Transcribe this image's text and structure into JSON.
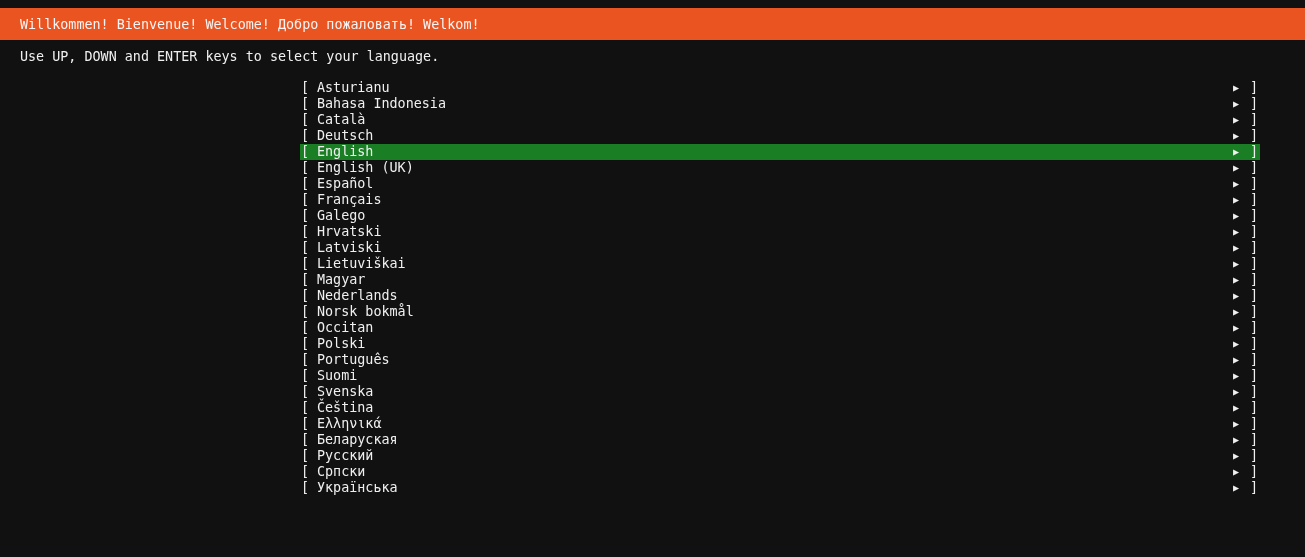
{
  "header": {
    "title": "Willkommen! Bienvenue! Welcome! Добро пожаловать! Welkom!"
  },
  "instruction": "Use UP, DOWN and ENTER keys to select your language.",
  "languages": [
    {
      "open": "[",
      "label": "Asturianu",
      "arrow": "▶",
      "close": "]",
      "selected": false
    },
    {
      "open": "[",
      "label": "Bahasa Indonesia",
      "arrow": "▶",
      "close": "]",
      "selected": false
    },
    {
      "open": "[",
      "label": "Català",
      "arrow": "▶",
      "close": "]",
      "selected": false
    },
    {
      "open": "[",
      "label": "Deutsch",
      "arrow": "▶",
      "close": "]",
      "selected": false
    },
    {
      "open": "[",
      "label": "English",
      "arrow": "▶",
      "close": "]",
      "selected": true
    },
    {
      "open": "[",
      "label": "English (UK)",
      "arrow": "▶",
      "close": "]",
      "selected": false
    },
    {
      "open": "[",
      "label": "Español",
      "arrow": "▶",
      "close": "]",
      "selected": false
    },
    {
      "open": "[",
      "label": "Français",
      "arrow": "▶",
      "close": "]",
      "selected": false
    },
    {
      "open": "[",
      "label": "Galego",
      "arrow": "▶",
      "close": "]",
      "selected": false
    },
    {
      "open": "[",
      "label": "Hrvatski",
      "arrow": "▶",
      "close": "]",
      "selected": false
    },
    {
      "open": "[",
      "label": "Latviski",
      "arrow": "▶",
      "close": "]",
      "selected": false
    },
    {
      "open": "[",
      "label": "Lietuviškai",
      "arrow": "▶",
      "close": "]",
      "selected": false
    },
    {
      "open": "[",
      "label": "Magyar",
      "arrow": "▶",
      "close": "]",
      "selected": false
    },
    {
      "open": "[",
      "label": "Nederlands",
      "arrow": "▶",
      "close": "]",
      "selected": false
    },
    {
      "open": "[",
      "label": "Norsk bokmål",
      "arrow": "▶",
      "close": "]",
      "selected": false
    },
    {
      "open": "[",
      "label": "Occitan",
      "arrow": "▶",
      "close": "]",
      "selected": false
    },
    {
      "open": "[",
      "label": "Polski",
      "arrow": "▶",
      "close": "]",
      "selected": false
    },
    {
      "open": "[",
      "label": "Português",
      "arrow": "▶",
      "close": "]",
      "selected": false
    },
    {
      "open": "[",
      "label": "Suomi",
      "arrow": "▶",
      "close": "]",
      "selected": false
    },
    {
      "open": "[",
      "label": "Svenska",
      "arrow": "▶",
      "close": "]",
      "selected": false
    },
    {
      "open": "[",
      "label": "Čeština",
      "arrow": "▶",
      "close": "]",
      "selected": false
    },
    {
      "open": "[",
      "label": "Ελληνικά",
      "arrow": "▶",
      "close": "]",
      "selected": false
    },
    {
      "open": "[",
      "label": "Беларуская",
      "arrow": "▶",
      "close": "]",
      "selected": false
    },
    {
      "open": "[",
      "label": "Русский",
      "arrow": "▶",
      "close": "]",
      "selected": false
    },
    {
      "open": "[",
      "label": "Српски",
      "arrow": "▶",
      "close": "]",
      "selected": false
    },
    {
      "open": "[",
      "label": "Українська",
      "arrow": "▶",
      "close": "]",
      "selected": false
    }
  ]
}
